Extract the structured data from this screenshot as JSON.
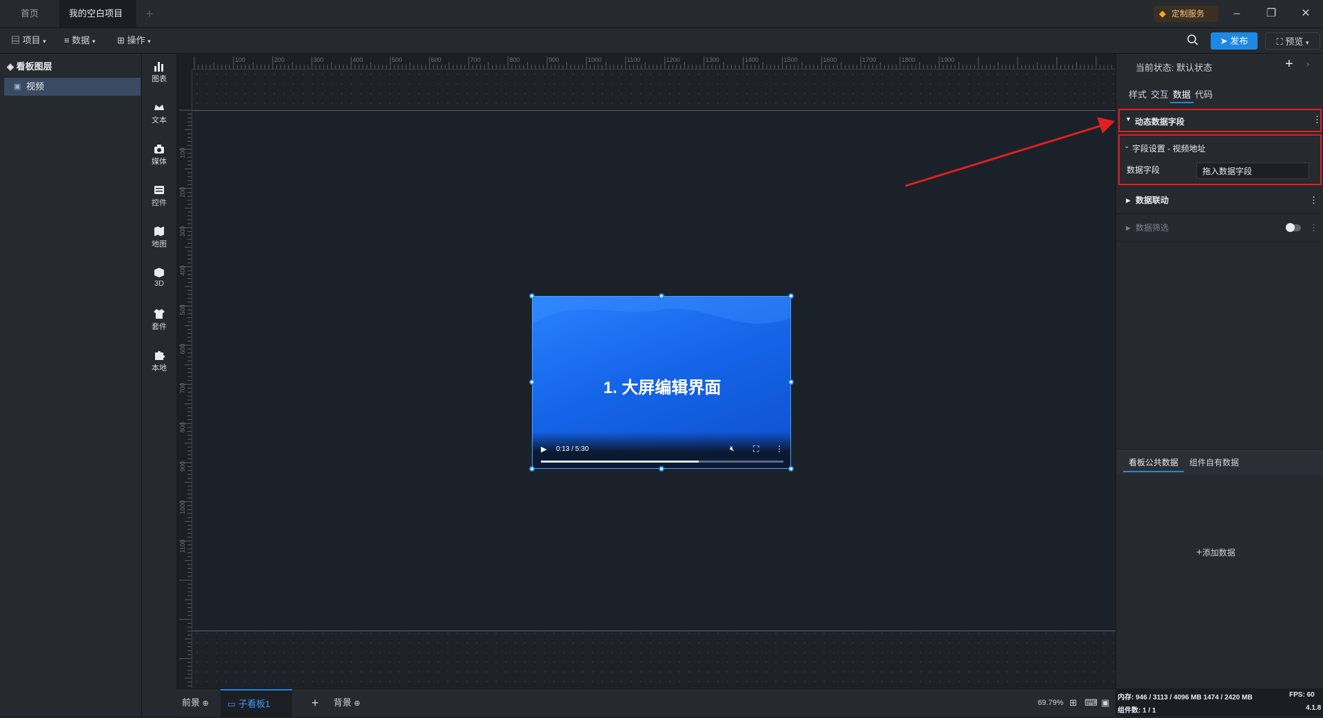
{
  "tabs": {
    "home": "首页",
    "project": "我的空白项目"
  },
  "window": {
    "service_label": "定制服务",
    "minimize": "–",
    "restore": "❐",
    "close": "✕"
  },
  "toolbar": {
    "menu_project": "项目",
    "menu_data": "数据",
    "menu_ops": "操作",
    "publish": "发布",
    "preview": "预览"
  },
  "layers": {
    "title": "看板图层",
    "items": [
      "视频"
    ]
  },
  "components": {
    "items": [
      "图表",
      "文本",
      "媒体",
      "控件",
      "地图",
      "3D",
      "套件",
      "本地"
    ]
  },
  "ruler": {
    "h_ticks": [
      "100",
      "200",
      "300",
      "400",
      "500",
      "600",
      "700",
      "800",
      "900",
      "1000",
      "1100",
      "1200",
      "1300",
      "1400",
      "1500",
      "1600",
      "1700",
      "1800",
      "1900"
    ],
    "v_ticks": [
      "100",
      "200",
      "300",
      "400",
      "500",
      "600",
      "700",
      "800",
      "900",
      "1000",
      "1100"
    ]
  },
  "video": {
    "title": "1. 大屏编辑界面",
    "time": "0:13 / 5:30",
    "progress": 0.65
  },
  "bottom": {
    "foreground": "前景",
    "board_tab": "子看板1",
    "background": "背景",
    "zoom": "69.79%"
  },
  "right_panel": {
    "state_label": "当前状态:",
    "state_value": "默认状态",
    "tabs": [
      "样式",
      "交互",
      "数据",
      "代码"
    ],
    "active_tab": "数据",
    "dynamic_field_title": "动态数据字段",
    "field_settings_title": "字段设置 - 视频地址",
    "data_field_label": "数据字段",
    "data_field_value": "拖入数据字段",
    "data_linkage": "数据联动",
    "data_filter": "数据筛选",
    "bottom_tabs": [
      "看板公共数据",
      "组件自有数据"
    ],
    "add_data": "添加数据"
  },
  "status": {
    "memory": "内存:  946 / 3113 / 4096 MB  1474 / 2420 MB",
    "fps": "FPS:  60",
    "components": "组件数: 1 / 1",
    "version": "4.1.8"
  },
  "colors": {
    "accent": "#1e88e5",
    "highlight": "#e02020",
    "tab_dot": "#f5a623"
  }
}
